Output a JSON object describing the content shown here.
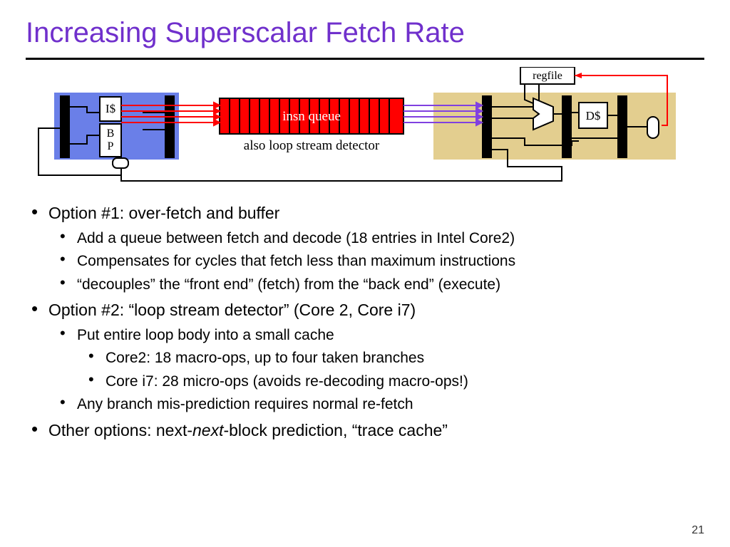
{
  "title": "Increasing Superscalar Fetch Rate",
  "page_number": "21",
  "diagram": {
    "regfile_label": "regfile",
    "icache_label": "I$",
    "bp_line1": "B",
    "bp_line2": "P",
    "queue_label": "insn queue",
    "queue_subtitle": "also loop stream detector",
    "dcache_label": "D$"
  },
  "bullets": {
    "b1": "Option #1: over-fetch and buffer",
    "b1a": "Add a queue between fetch and decode (18 entries in Intel Core2)",
    "b1b": "Compensates for cycles that fetch less than maximum instructions",
    "b1c": "“decouples” the “front end” (fetch) from the “back end” (execute)",
    "b2": "Option #2: “loop stream detector” (Core 2, Core i7)",
    "b2a": "Put entire loop body into a small cache",
    "b2aa": "Core2: 18 macro-ops, up to four taken branches",
    "b2ab": "Core i7: 28 micro-ops (avoids re-decoding macro-ops!)",
    "b2b": "Any branch mis-prediction requires normal re-fetch",
    "b3_pre": "Other options: next-",
    "b3_ital": "next",
    "b3_post": "-block prediction, “trace cache”"
  }
}
